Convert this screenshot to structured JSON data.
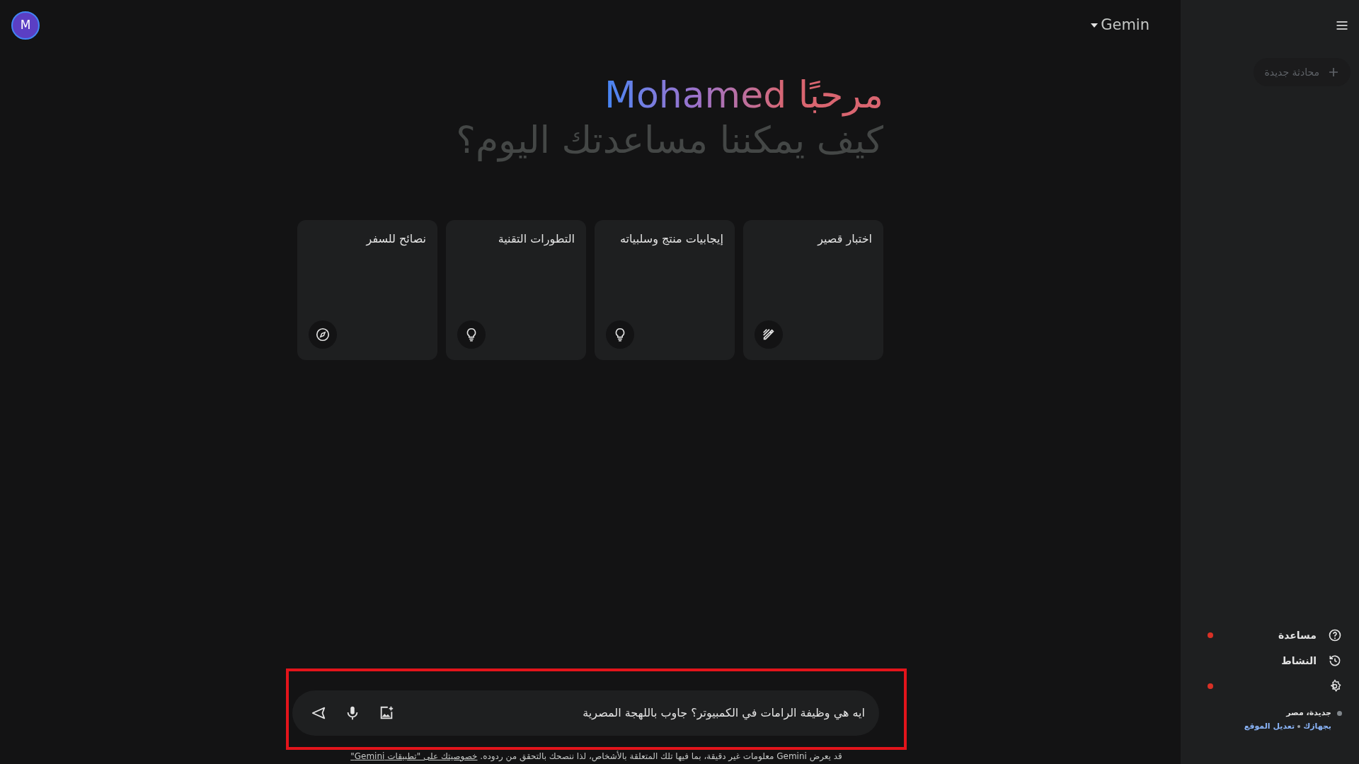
{
  "top_bar": {
    "avatar_letter": "M",
    "model_menu": "Gemin"
  },
  "greeting": {
    "salutation": "مرحبًا",
    "name": "Mohamed",
    "question": "كيف يمكننا مساعدتك اليوم؟"
  },
  "suggestions": [
    {
      "text": "اختبار قصير",
      "kind": "pencil"
    },
    {
      "text": "إيجابيات منتج وسلبياته",
      "kind": "bulb"
    },
    {
      "text": "التطورات التقنية",
      "kind": "bulb"
    },
    {
      "text": "نصائح للسفر",
      "kind": "compass"
    }
  ],
  "prompt": {
    "value": "ايه هي وظيفة الرامات في الكمبيوتر؟ جاوب باللهجة المصرية"
  },
  "disclaimer": {
    "text": "قد يعرض Gemini معلومات غير دقيقة، بما فيها تلك المتعلقة بالأشخاص، لذا ننصحك بالتحقق من ردوده.",
    "link": "خصوصيتك على \"تطبيقات Gemini\""
  },
  "sidebar": {
    "new_chat": "محادثة جديدة",
    "items": [
      {
        "label": "مساعدة",
        "kind": "help",
        "badge": true
      },
      {
        "label": "النشاط",
        "kind": "history",
        "badge": false
      },
      {
        "kind": "settings",
        "badge": true
      }
    ],
    "location": {
      "place": "جديدة، مصر",
      "links": [
        "بجهازك",
        "تعديل الموقع"
      ]
    }
  }
}
